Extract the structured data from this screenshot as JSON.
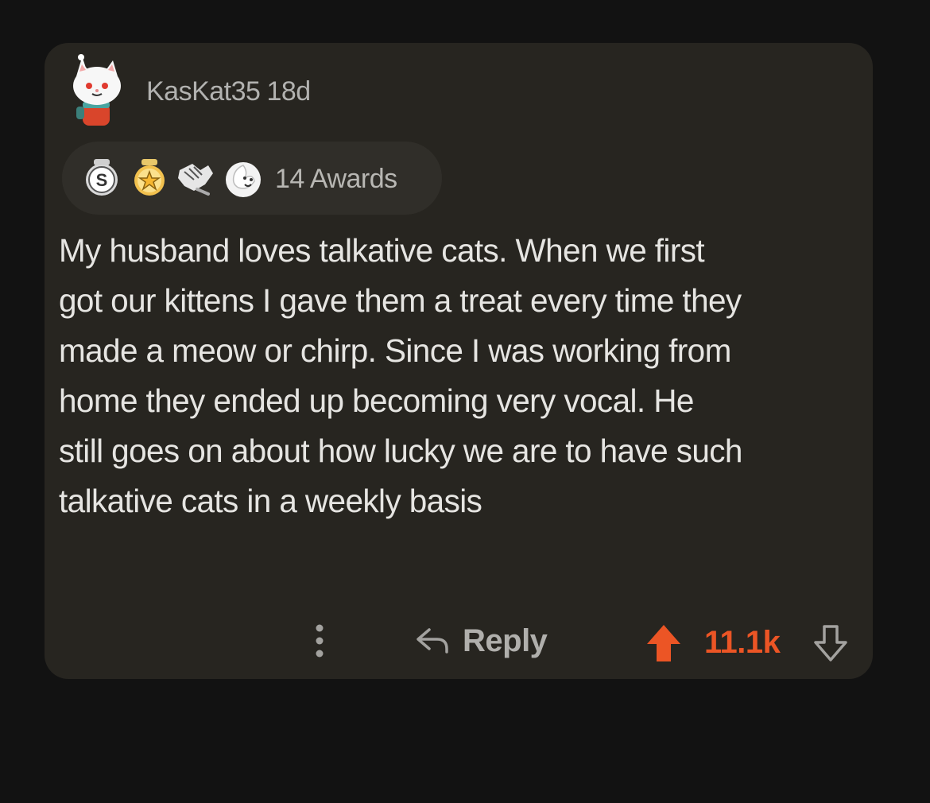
{
  "comment": {
    "username": "KasKat35",
    "age": "18d",
    "awards_label": "14 Awards",
    "award_icons": [
      "silver-award-icon",
      "gold-star-award-icon",
      "handshake-award-icon",
      "wholesome-award-icon"
    ],
    "body_lines": [
      "My husband loves talkative cats.  When we first",
      "got our kittens I gave them a treat every time they",
      "made a meow or chirp.  Since I was working from",
      "home they ended up becoming very vocal. He",
      "still goes on about how lucky we are to have such",
      "talkative cats in a weekly basis"
    ],
    "score": "11.1k"
  },
  "actions": {
    "reply_label": "Reply"
  },
  "colors": {
    "background": "#121212",
    "card": "#272520",
    "upvote": "#ec5525",
    "text": "#e6e5e2",
    "muted": "#b2b2b0"
  }
}
